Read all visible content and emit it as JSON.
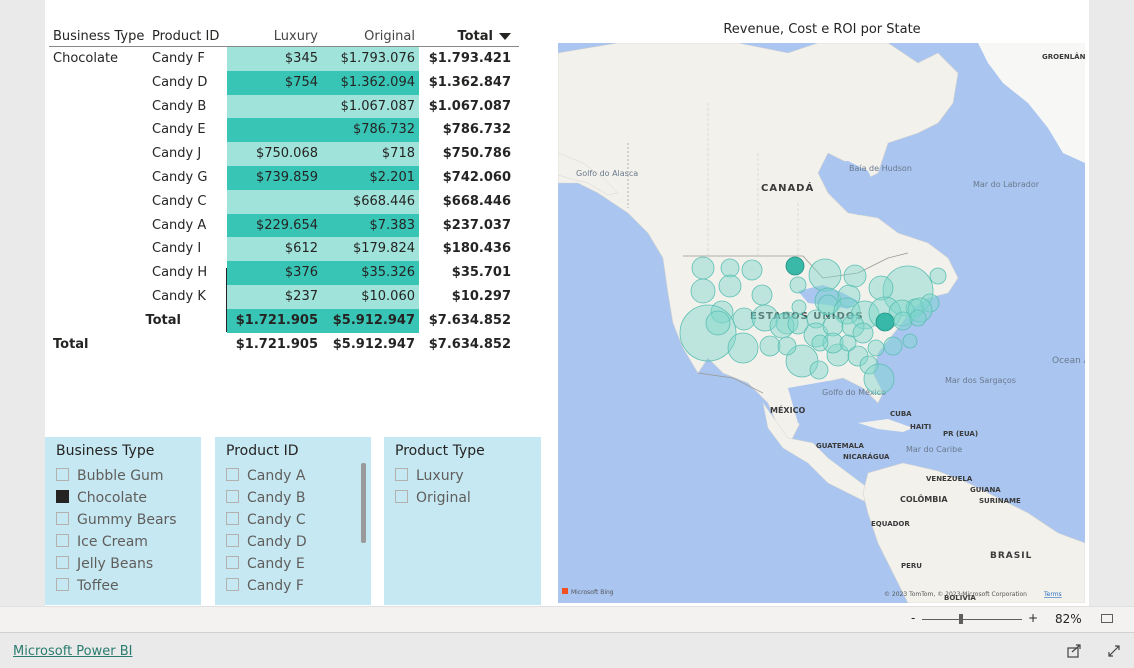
{
  "matrix": {
    "headers": {
      "business_type": "Business Type",
      "product_id": "Product ID",
      "luxury": "Luxury",
      "original": "Original",
      "total": "Total"
    },
    "group": "Chocolate",
    "rows": [
      {
        "product": "Candy F",
        "luxury": "$345",
        "original": "$1.793.076",
        "total": "$1.793.421"
      },
      {
        "product": "Candy D",
        "luxury": "$754",
        "original": "$1.362.094",
        "total": "$1.362.847"
      },
      {
        "product": "Candy B",
        "luxury": "",
        "original": "$1.067.087",
        "total": "$1.067.087"
      },
      {
        "product": "Candy E",
        "luxury": "",
        "original": "$786.732",
        "total": "$786.732"
      },
      {
        "product": "Candy J",
        "luxury": "$750.068",
        "original": "$718",
        "total": "$750.786"
      },
      {
        "product": "Candy G",
        "luxury": "$739.859",
        "original": "$2.201",
        "total": "$742.060"
      },
      {
        "product": "Candy C",
        "luxury": "",
        "original": "$668.446",
        "total": "$668.446"
      },
      {
        "product": "Candy A",
        "luxury": "$229.654",
        "original": "$7.383",
        "total": "$237.037"
      },
      {
        "product": "Candy I",
        "luxury": "$612",
        "original": "$179.824",
        "total": "$180.436"
      },
      {
        "product": "Candy H",
        "luxury": "$376",
        "original": "$35.326",
        "total": "$35.701"
      },
      {
        "product": "Candy K",
        "luxury": "$237",
        "original": "$10.060",
        "total": "$10.297"
      }
    ],
    "subtotal": {
      "label": "Total",
      "luxury": "$1.721.905",
      "original": "$5.912.947",
      "total": "$7.634.852"
    },
    "grand_total": {
      "label": "Total",
      "luxury": "$1.721.905",
      "original": "$5.912.947",
      "total": "$7.634.852"
    }
  },
  "map": {
    "title": "Revenue, Cost e ROI por State",
    "labels": {
      "canada": "CANADÁ",
      "usa": "ESTADOS UNIDOS",
      "mexico": "MÉXICO",
      "gulf_alaska": "Golfo do Alasca",
      "hudson": "Baía de Hudson",
      "labrador": "Mar do Labrador",
      "greenland": "GROENLÂN (DIN)",
      "gulf_mexico": "Golfo do México",
      "sargasso": "Mar dos Sargaços",
      "atlantic": "Ocean Atlânti",
      "cuba": "CUBA",
      "haiti": "HAITI",
      "pr": "PR (EUA)",
      "guatemala": "GUATEMALA",
      "nicaragua": "NICARÁGUA",
      "caribbean": "Mar do Caribe",
      "venezuela": "VENEZUELA",
      "guiana": "GUIANA",
      "suriname": "SURINAME",
      "colombia": "COLÔMBIA",
      "ecuador": "EQUADOR",
      "peru": "PERU",
      "brazil": "BRASIL",
      "bolivia": "BOLÍVIA",
      "bing": "Microsoft Bing",
      "copyright": "© 2023 TomTom, © 2023 Microsoft Corporation",
      "terms": "Terms"
    },
    "colors": {
      "ocean": "#a9c5f0",
      "land": "#f2f1ec",
      "bubble": "#7fd6cc",
      "bubble_dark": "#2fb5a4"
    }
  },
  "slicers": {
    "business_type": {
      "title": "Business Type",
      "items": [
        {
          "label": "Bubble Gum",
          "checked": false
        },
        {
          "label": "Chocolate",
          "checked": true
        },
        {
          "label": "Gummy Bears",
          "checked": false
        },
        {
          "label": "Ice Cream",
          "checked": false
        },
        {
          "label": "Jelly Beans",
          "checked": false
        },
        {
          "label": "Toffee",
          "checked": false
        }
      ]
    },
    "product_id": {
      "title": "Product ID",
      "items": [
        {
          "label": "Candy A",
          "checked": false
        },
        {
          "label": "Candy B",
          "checked": false
        },
        {
          "label": "Candy C",
          "checked": false
        },
        {
          "label": "Candy D",
          "checked": false
        },
        {
          "label": "Candy E",
          "checked": false
        },
        {
          "label": "Candy F",
          "checked": false
        }
      ]
    },
    "product_type": {
      "title": "Product Type",
      "items": [
        {
          "label": "Luxury",
          "checked": false
        },
        {
          "label": "Original",
          "checked": false
        }
      ]
    }
  },
  "zoom": {
    "minus": "-",
    "plus": "+",
    "level": "82%"
  },
  "footer": {
    "link": "Microsoft Power BI"
  }
}
